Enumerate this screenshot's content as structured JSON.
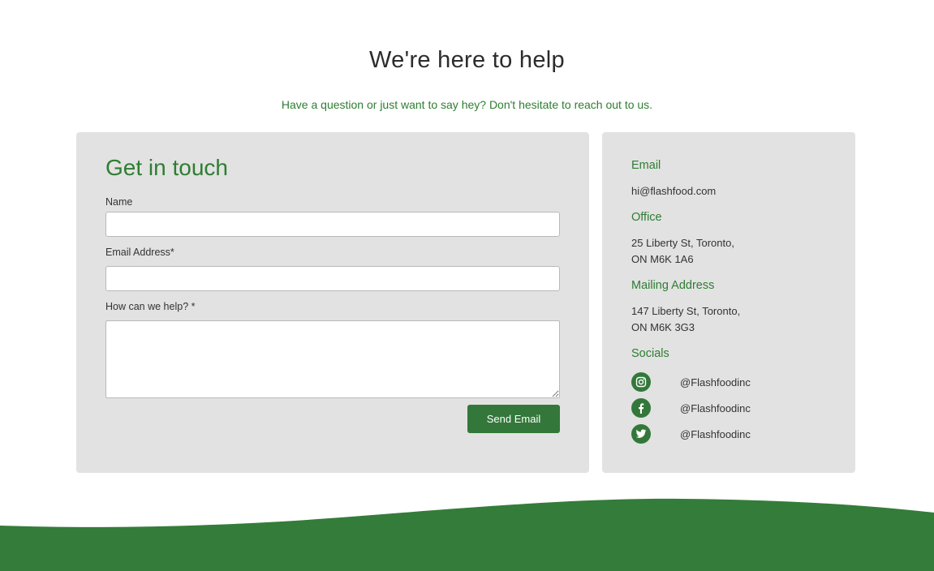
{
  "hero": {
    "title": "We're here to help",
    "subtitle": "Have a question or just want to say hey? Don't hesitate to reach out to us."
  },
  "form": {
    "title": "Get in touch",
    "name_label": "Name",
    "name_value": "",
    "email_label": "Email Address*",
    "email_value": "",
    "message_label": "How can we help? *",
    "message_value": "",
    "submit_label": "Send Email"
  },
  "contact": {
    "email_heading": "Email",
    "email_value": "hi@flashfood.com",
    "office_heading": "Office",
    "office_line1": "25 Liberty St, Toronto,",
    "office_line2": "ON M6K 1A6",
    "mailing_heading": "Mailing Address",
    "mailing_line1": "147 Liberty St, Toronto,",
    "mailing_line2": "ON M6K 3G3",
    "socials_heading": "Socials",
    "socials": [
      {
        "icon": "instagram-icon",
        "handle": "@Flashfoodinc"
      },
      {
        "icon": "facebook-icon",
        "handle": "@Flashfoodinc"
      },
      {
        "icon": "twitter-icon",
        "handle": "@Flashfoodinc"
      }
    ]
  },
  "colors": {
    "accent": "#2e7d32",
    "button": "#33783a",
    "card_bg": "#e2e2e2",
    "footer_wave": "#347c3a"
  }
}
